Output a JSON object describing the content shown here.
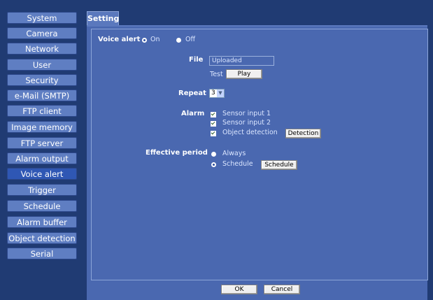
{
  "sidebar": {
    "items": [
      {
        "label": "System"
      },
      {
        "label": "Camera"
      },
      {
        "label": "Network"
      },
      {
        "label": "User"
      },
      {
        "label": "Security"
      },
      {
        "label": "e-Mail (SMTP)"
      },
      {
        "label": "FTP client"
      },
      {
        "label": "Image memory"
      },
      {
        "label": "FTP server"
      },
      {
        "label": "Alarm output"
      },
      {
        "label": "Voice alert"
      },
      {
        "label": "Trigger"
      },
      {
        "label": "Schedule"
      },
      {
        "label": "Alarm buffer"
      },
      {
        "label": "Object detection"
      },
      {
        "label": "Serial"
      }
    ]
  },
  "tab": {
    "label": "Setting"
  },
  "voice_alert": {
    "label": "Voice alert",
    "on_label": "On",
    "off_label": "Off",
    "selected": "On"
  },
  "file": {
    "label": "File",
    "value": "Uploaded",
    "test_label": "Test",
    "play_button": "Play"
  },
  "repeat": {
    "label": "Repeat",
    "value": "3"
  },
  "alarm": {
    "label": "Alarm",
    "options": [
      {
        "label": "Sensor input 1",
        "checked": true
      },
      {
        "label": "Sensor input 2",
        "checked": true
      },
      {
        "label": "Object detection",
        "checked": true
      }
    ],
    "detection_button": "Detection"
  },
  "effective_period": {
    "label": "Effective period",
    "always_label": "Always",
    "schedule_label": "Schedule",
    "selected": "Schedule",
    "schedule_button": "Schedule"
  },
  "footer": {
    "ok_button": "OK",
    "cancel_button": "Cancel"
  },
  "colors": {
    "sidebar_bg": "#203b73",
    "button_bg": "#5f7ec2",
    "active_button_bg": "#2f57b4",
    "panel_bg": "#4a68b0"
  }
}
